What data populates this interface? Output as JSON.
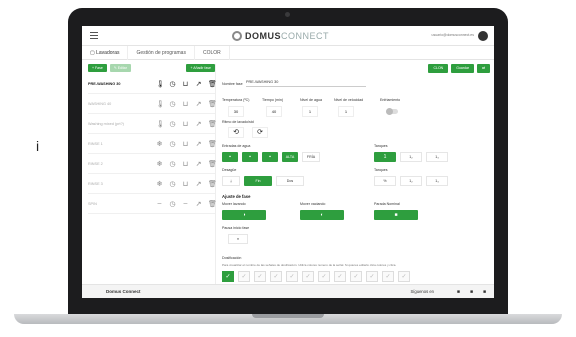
{
  "side_text": "i",
  "app": {
    "logo": {
      "prefix": "DOMUS",
      "suffix": "CONNECT"
    },
    "user_email": "usuario@domusconnect.es"
  },
  "tabs": [
    {
      "label": "Lavadoras"
    },
    {
      "label": "Gestión de programas"
    },
    {
      "label": "COLOR"
    }
  ],
  "actions": [
    {
      "label": "CLON"
    },
    {
      "label": "Guardar"
    },
    {
      "label": "⇄"
    }
  ],
  "sidebar": {
    "buttons": {
      "add": "+ Fase",
      "edit": "✎ Editar",
      "add_phase": "+ Añadir fase"
    },
    "programs": [
      {
        "name": "PRE-WASHING 30",
        "active": true
      },
      {
        "name": "WASHING 40",
        "active": false
      },
      {
        "name": "Washing mixed (prt?)",
        "active": false
      },
      {
        "name": "RINSE 1",
        "active": false
      },
      {
        "name": "RINSE 2",
        "active": false
      },
      {
        "name": "RINSE 3",
        "active": false
      },
      {
        "name": "SPIN",
        "active": false
      }
    ]
  },
  "form": {
    "phase_name_label": "Nombre fase",
    "phase_name_value": "PRE-WASHING 30",
    "temp_label": "Temperatura (ºC)",
    "time_label": "Tiempo (min)",
    "water_label": "Nivel de agua",
    "speed_label": "Nivel de velocidad",
    "cooling_label": "Enfriamiento",
    "temp_value": "30",
    "time_value": "40",
    "water_value": "1",
    "speed_value": "1",
    "drum_label": "Ritmo de lavado/std",
    "water_inlets_label": "Entradas de agua",
    "inlet_hot": "ALTA",
    "inlet_cold": "FRÍA",
    "tanks_label": "Tanques",
    "tank_options": [
      "1",
      "1₂",
      "1₃"
    ],
    "drain_label": "Desagüe",
    "drain_value": "Fin",
    "drain_opt": "Dos",
    "tanks2_label": "Tanques",
    "tank2_options": [
      "%",
      "1₂",
      "1₃"
    ],
    "adjust_label": "Ajuste de fase",
    "wash_label": "Mover lavando",
    "drain_wash_label": "Mover vaciando",
    "stop_label": "Parada Nominal",
    "pause_label": "Pausa inicio fase",
    "dosing_label": "Dosificación",
    "dosing_hint": "Para visualizar el nombre de las señales de dosificación. Utiliza colores numero de la señal. Si quieres editarlo clica colores y clica."
  },
  "footer": {
    "brand": "Domus Connect",
    "follow": "Síguenos en"
  }
}
